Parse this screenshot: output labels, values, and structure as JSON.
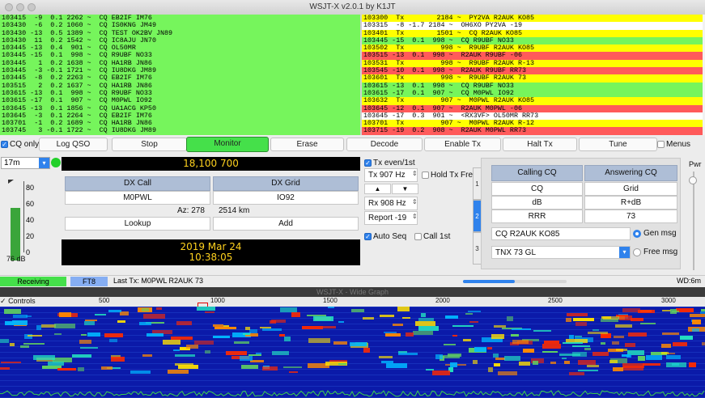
{
  "window": {
    "title": "WSJT-X   v2.0.1   by K1JT"
  },
  "band_activity": [
    "103415  -9  0.1 2262 ~  CQ EB2IF IM76",
    "103430  -6  0.2 1060 ~  CQ IS0KNG JM49",
    "103430 -13  0.5 1389 ~  CQ TEST OK2BV JN89",
    "103430  11  0.2 1542 ~  CQ IC8AJU JN70",
    "103445 -13  0.4  901 ~  CQ OL50MR",
    "103445 -15  0.1  998 ~  CQ R9UBF NO33",
    "103445   1  0.2 1638 ~  CQ HA1RB JN86",
    "103445  -3 -0.1 1721 ~  CQ IU8DKG JM89",
    "103445  -8  0.2 2263 ~  CQ EB2IF IM76",
    "103515   2  0.2 1637 ~  CQ HA1RB JN86",
    "103615 -13  0.1  998 ~  CQ R9UBF NO33",
    "103615 -17  0.1  907 ~  CQ M0PWL IO92",
    "103645 -13  0.1 1856 ~  CQ UA1ACG KP50",
    "103645  -3  0.1 2264 ~  CQ EB2IF IM76",
    "103701  -1  0.2 1689 ~  CQ HA1RB JN86",
    "103745   3 -0.1 1722 ~  CQ IU8DKG JM89",
    "103745  -2  0.1 2265 ~  CQ EB2IF IM76"
  ],
  "rx_frequency": [
    {
      "text": "103300  Tx        2184 ~  PY2VA R2AUK KO85",
      "bg": "#ffff00"
    },
    {
      "text": "103315  -8 -1.7 2184 ~  OH6XO PY2VA -19",
      "bg": "#ffffff"
    },
    {
      "text": "103401  Tx        1501 ~  CQ R2AUK KO85",
      "bg": "#ffff00"
    },
    {
      "text": "103445 -15  0.1  998 ~  CQ R9UBF NO33",
      "bg": "#76f55c"
    },
    {
      "text": "103502  Tx         998 ~  R9UBF R2AUK KO85",
      "bg": "#ffff00"
    },
    {
      "text": "103515 -13  0.1  998 ~  R2AUK R9UBF -06",
      "bg": "#ff5a5a"
    },
    {
      "text": "103531  Tx         998 ~  R9UBF R2AUK R-13",
      "bg": "#ffff00"
    },
    {
      "text": "103545 -10  0.1  998 ~  R2AUK R9UBF RR73",
      "bg": "#ff5a5a"
    },
    {
      "text": "103601  Tx         998 ~  R9UBF R2AUK 73",
      "bg": "#ffff00"
    },
    {
      "text": "103615 -13  0.1  998 ~  CQ R9UBF NO33",
      "bg": "#76f55c"
    },
    {
      "text": "103615 -17  0.1  907 ~  CQ M0PWL IO92",
      "bg": "#76f55c"
    },
    {
      "text": "103632  Tx         907 ~  M0PWL R2AUK KO85",
      "bg": "#ffff00"
    },
    {
      "text": "103645 -12  0.1  907 ~  R2AUK M0PWL -06",
      "bg": "#ff5a5a"
    },
    {
      "text": "103645 -17  0.3  901 ~  <RX3VF> OL50MR RR73",
      "bg": "#ffffff"
    },
    {
      "text": "103701  Tx         907 ~  M0PWL R2AUK R-12",
      "bg": "#ffff00"
    },
    {
      "text": "103715 -19  0.2  908 ~  R2AUK M0PWL RR73",
      "bg": "#ff5a5a"
    },
    {
      "text": "103731  Tx         907 ~  M0PWL R2AUK 73",
      "bg": "#ffff00"
    }
  ],
  "controls": {
    "cq_only": "CQ only",
    "log_qso": "Log QSO",
    "stop": "Stop",
    "monitor": "Monitor",
    "erase": "Erase",
    "decode": "Decode",
    "enable_tx": "Enable Tx",
    "halt_tx": "Halt Tx",
    "tune": "Tune",
    "menus": "Menus"
  },
  "band": "17m",
  "frequency": "18,100 700",
  "meter": {
    "ticks": [
      "80",
      "60",
      "40",
      "20",
      "0"
    ],
    "level_db": "76 dB",
    "level_fraction": 0.72
  },
  "dx": {
    "call_header": "DX Call",
    "grid_header": "DX Grid",
    "call": "M0PWL",
    "grid": "IO92",
    "az": "Az: 278",
    "distance": "2514 km",
    "lookup": "Lookup",
    "add": "Add"
  },
  "datetime": {
    "date": "2019 Mar 24",
    "time": "10:38:05"
  },
  "tx": {
    "even_first": "Tx even/1st",
    "tx_freq": "Tx  907  Hz",
    "hold_tx_freq": "Hold Tx Freq",
    "rx_freq": "Rx  908  Hz",
    "report": "Report -19",
    "auto_seq": "Auto Seq",
    "call_1st": "Call 1st"
  },
  "calling": {
    "calling_cq": "Calling CQ",
    "answering_cq": "Answering CQ",
    "cq": "CQ",
    "grid": "Grid",
    "db": "dB",
    "r_db": "R+dB",
    "rrr": "RRR",
    "seventy_three": "73",
    "gen_text": "CQ R2AUK KO85",
    "gen_msg": "Gen msg",
    "free_text": "TNX 73 GL",
    "free_msg": "Free msg"
  },
  "tabs": [
    "1",
    "2",
    "3"
  ],
  "pwr": "Pwr",
  "status": {
    "receiving": "Receiving",
    "mode": "FT8",
    "last_tx": "Last Tx: M0PWL R2AUK 73",
    "wd": "WD:6m",
    "progress_fraction": 0.5
  },
  "wide_graph": {
    "title": "WSJT-X - Wide Graph",
    "controls": "Controls",
    "ticks": [
      "500",
      "1000",
      "1500",
      "2000",
      "2500",
      "3000"
    ]
  },
  "colors": {
    "accent": "#2f82ec",
    "monitor": "#45e04a",
    "decode_green": "#76f55c",
    "tx_yellow": "#ffff00",
    "reply_red": "#ff5a5a",
    "freq_text": "#ffd21e"
  }
}
